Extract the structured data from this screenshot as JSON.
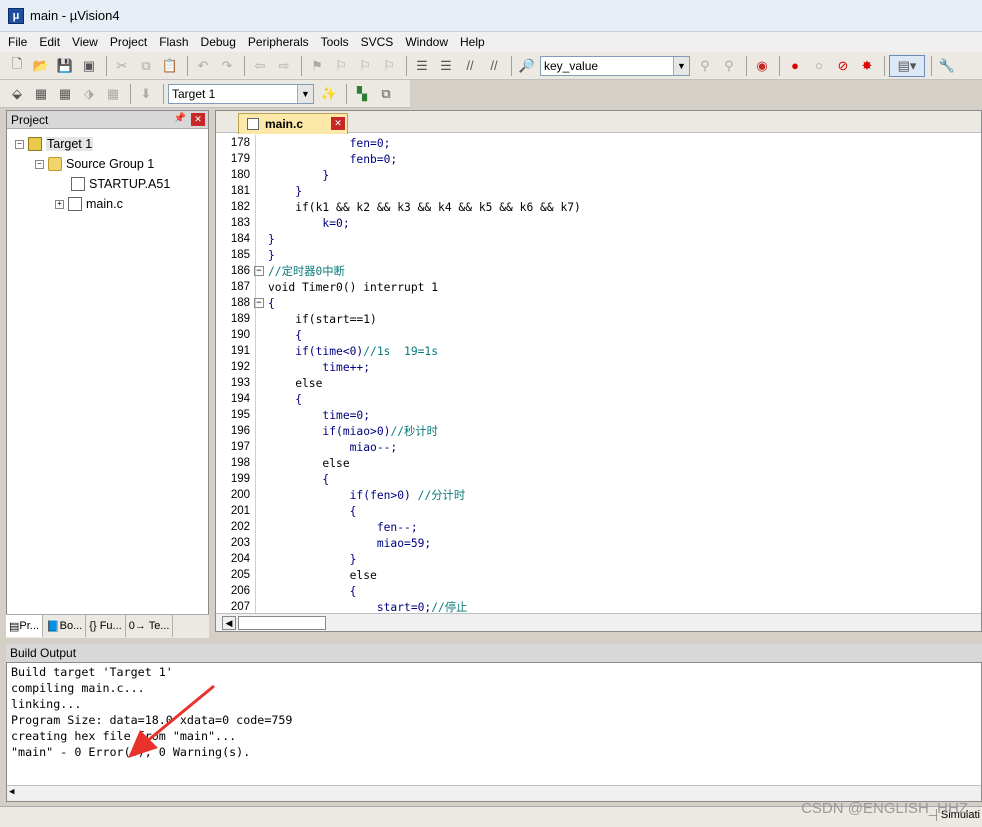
{
  "window": {
    "title": "main  - µVision4"
  },
  "menu": [
    "File",
    "Edit",
    "View",
    "Project",
    "Flash",
    "Debug",
    "Peripherals",
    "Tools",
    "SVCS",
    "Window",
    "Help"
  ],
  "toolbar": {
    "find_combo_value": "key_value",
    "target_combo_value": "Target 1"
  },
  "project": {
    "panel_title": "Project",
    "tree": {
      "target": "Target 1",
      "group": "Source Group 1",
      "files": [
        "STARTUP.A51",
        "main.c"
      ]
    },
    "tabs": [
      "Pr...",
      "Bo...",
      "{} Fu...",
      "0→ Te..."
    ]
  },
  "editor": {
    "tab_name": "main.c",
    "lines": [
      {
        "n": "178",
        "code": "            fen=0;"
      },
      {
        "n": "179",
        "code": "            fenb=0;"
      },
      {
        "n": "180",
        "code": "        }"
      },
      {
        "n": "181",
        "code": "    }"
      },
      {
        "n": "182",
        "code": "    if(k1 && k2 && k3 && k4 && k5 && k6 && k7)"
      },
      {
        "n": "183",
        "code": "        k=0;"
      },
      {
        "n": "184",
        "code": "}"
      },
      {
        "n": "185",
        "code": "}"
      },
      {
        "n": "186",
        "code": "//定时器0中断"
      },
      {
        "n": "187",
        "code": "void Timer0() interrupt 1"
      },
      {
        "n": "188",
        "code": "{"
      },
      {
        "n": "189",
        "code": "    if(start==1)"
      },
      {
        "n": "190",
        "code": "    {"
      },
      {
        "n": "191",
        "code": "    if(time<0)//1s  19=1s"
      },
      {
        "n": "192",
        "code": "        time++;"
      },
      {
        "n": "193",
        "code": "    else"
      },
      {
        "n": "194",
        "code": "    {"
      },
      {
        "n": "195",
        "code": "        time=0;"
      },
      {
        "n": "196",
        "code": "        if(miao>0)//秒计时"
      },
      {
        "n": "197",
        "code": "            miao--;"
      },
      {
        "n": "198",
        "code": "        else"
      },
      {
        "n": "199",
        "code": "        {"
      },
      {
        "n": "200",
        "code": "            if(fen>0) //分计时"
      },
      {
        "n": "201",
        "code": "            {"
      },
      {
        "n": "202",
        "code": "                fen--;"
      },
      {
        "n": "203",
        "code": "                miao=59;"
      },
      {
        "n": "204",
        "code": "            }"
      },
      {
        "n": "205",
        "code": "            else"
      },
      {
        "n": "206",
        "code": "            {"
      },
      {
        "n": "207",
        "code": "                start=0;//停止"
      }
    ]
  },
  "build_output": {
    "title": "Build Output",
    "lines": [
      "Build target 'Target 1'",
      "compiling main.c...",
      "linking...",
      "Program Size: data=18.0 xdata=0 code=759",
      "creating hex file from \"main\"...",
      "\"main\" - 0 Error(s), 0 Warning(s)."
    ]
  },
  "status": {
    "mode": "Simulati"
  },
  "watermark": "CSDN @ENGLISH_HHZ",
  "colors": {
    "keyword": "#000080",
    "comment": "#0a7a7a",
    "annotation_arrow": "#e8322b"
  }
}
